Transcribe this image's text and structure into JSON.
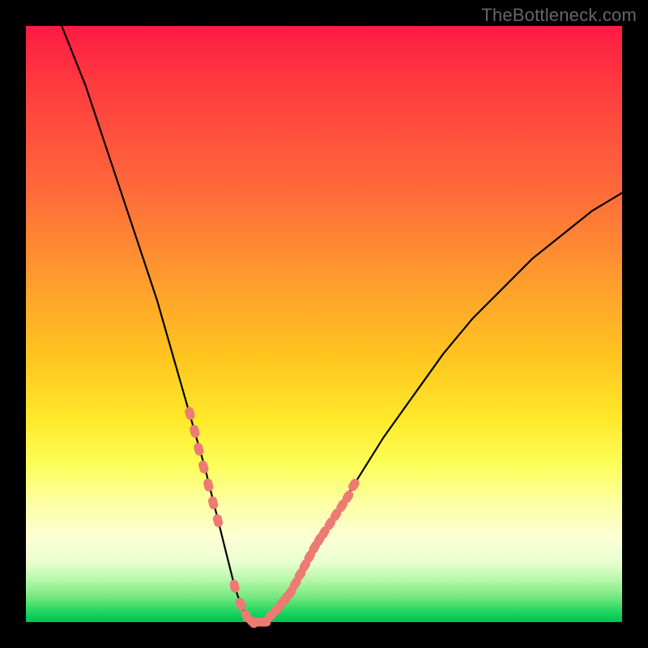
{
  "watermark": "TheBottleneck.com",
  "colors": {
    "background": "#000000",
    "curve": "#000000",
    "markers": "#ed7a73",
    "gradient_top": "#ff1a43",
    "gradient_bottom": "#00c351"
  },
  "chart_data": {
    "type": "line",
    "title": "",
    "xlabel": "",
    "ylabel": "",
    "xlim": [
      0,
      100
    ],
    "ylim": [
      0,
      100
    ],
    "series": [
      {
        "name": "bottleneck-curve",
        "x": [
          6,
          10,
          14,
          18,
          22,
          26,
          28,
          30,
          32,
          34,
          35,
          36,
          37,
          38,
          40,
          42,
          46,
          50,
          55,
          60,
          65,
          70,
          75,
          80,
          85,
          90,
          95,
          100
        ],
        "values": [
          100,
          90,
          78,
          66,
          54,
          40,
          33,
          26,
          18,
          10,
          6,
          3,
          1,
          0,
          0,
          2,
          8,
          15,
          23,
          31,
          38,
          45,
          51,
          56,
          61,
          65,
          69,
          72
        ]
      }
    ],
    "markers": {
      "name": "highlighted-points",
      "x": [
        27.5,
        28.3,
        29.0,
        29.8,
        30.6,
        31.4,
        32.2,
        35.0,
        36.0,
        37.0,
        38.0,
        39.0,
        40.0,
        41.0,
        42.0,
        42.8,
        43.6,
        44.4,
        45.2,
        46.0,
        46.8,
        47.6,
        48.4,
        49.2,
        50.0,
        51.0,
        52.0,
        53.0,
        54.0,
        55.0
      ],
      "approx_y": [
        35,
        32,
        29,
        26,
        23,
        20,
        17,
        6,
        3,
        1,
        0,
        0,
        0,
        1,
        2,
        3,
        4,
        5,
        6.5,
        8,
        9.5,
        11,
        12.5,
        13.8,
        15,
        16.5,
        18,
        19.5,
        21,
        23
      ]
    }
  }
}
